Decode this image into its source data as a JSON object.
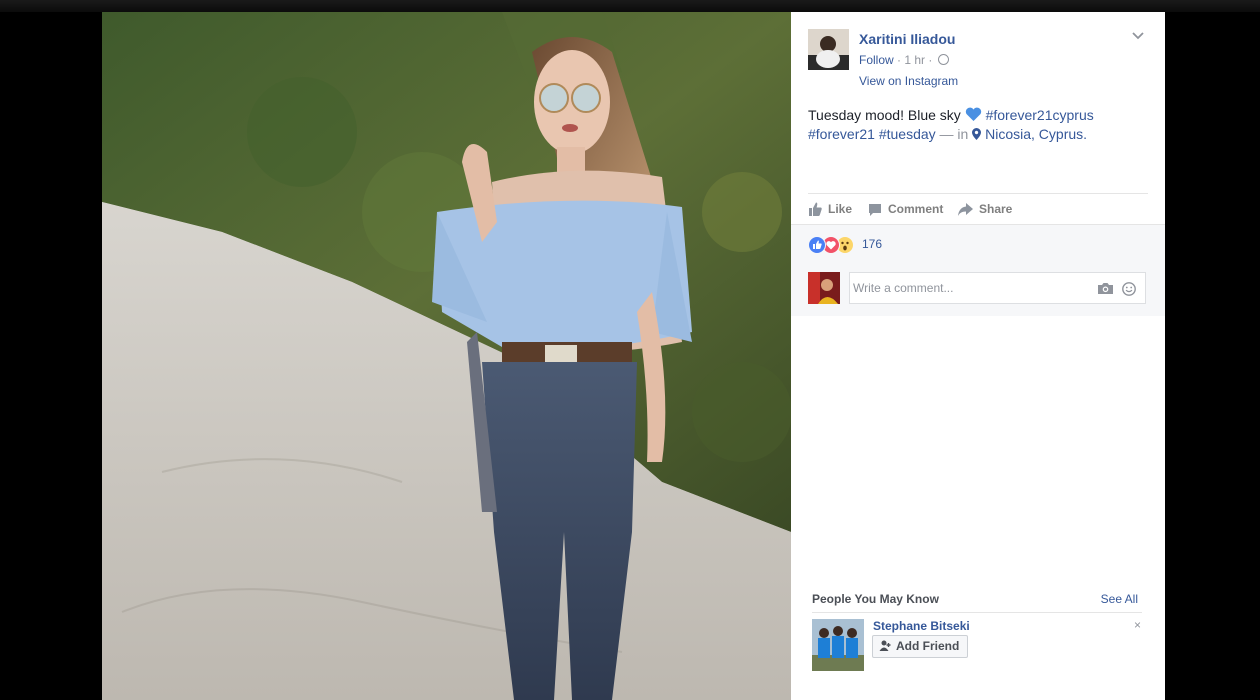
{
  "post": {
    "author_name": "Xaritini Iliadou",
    "follow_label": "Follow",
    "time_sep": "·",
    "time": "1 hr",
    "time_sep2": "·",
    "view_instagram": "View on Instagram",
    "caption": {
      "text1": "Tuesday mood! Blue sky",
      "heart_color": "#4a90e2",
      "tag1": "#forever21cyprus",
      "tag2": "#forever21",
      "tag3": "#tuesday",
      "in_text": "— in",
      "location": "Nicosia, Cyprus."
    }
  },
  "actions": {
    "like": "Like",
    "comment": "Comment",
    "share": "Share"
  },
  "reactions": {
    "count": "176",
    "types": [
      "like",
      "love",
      "wow"
    ]
  },
  "comment_box": {
    "placeholder": "Write a comment..."
  },
  "people_you_may_know": {
    "title": "People You May Know",
    "see_all": "See All",
    "people": [
      {
        "name": "Stephane Bitseki",
        "button": "Add Friend",
        "close": "×"
      }
    ]
  },
  "colors": {
    "link": "#365899",
    "muted": "#90949c",
    "background": "#000000"
  }
}
